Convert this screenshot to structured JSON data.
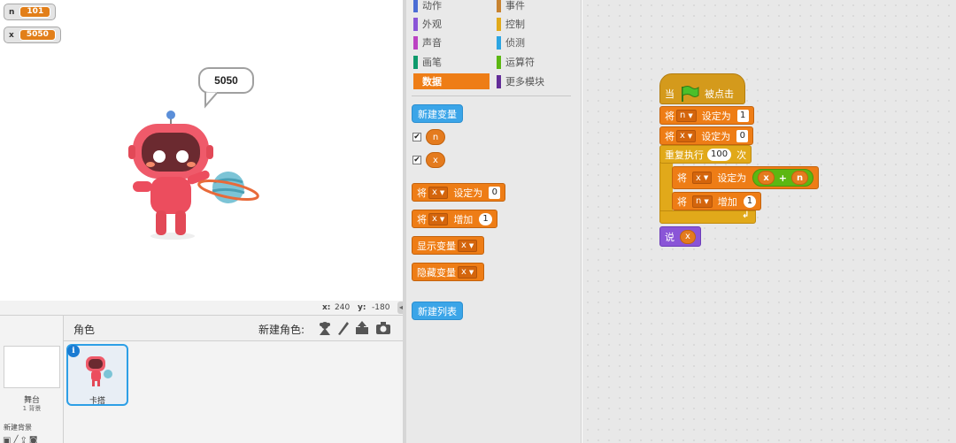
{
  "stage": {
    "monitors": [
      {
        "name": "n",
        "value": "101"
      },
      {
        "name": "x",
        "value": "5050"
      }
    ],
    "speech": "5050"
  },
  "coords": {
    "x_label": "x:",
    "x_value": "240",
    "y_label": "y:",
    "y_value": "-180"
  },
  "sprites": {
    "header_title": "角色",
    "new_sprite_label": "新建角色:",
    "stage_label": "舞台",
    "stage_backdrops": "1 背景",
    "new_backdrop_label": "新建背景",
    "sprite_name": "卡搭",
    "info_icon": "i"
  },
  "palette": {
    "categories": [
      {
        "label": "动作",
        "color": "#4a6cd4"
      },
      {
        "label": "事件",
        "color": "#c88330"
      },
      {
        "label": "外观",
        "color": "#8a55d7"
      },
      {
        "label": "控制",
        "color": "#e1a91a"
      },
      {
        "label": "声音",
        "color": "#bb42c3"
      },
      {
        "label": "侦测",
        "color": "#2ca5e2"
      },
      {
        "label": "画笔",
        "color": "#0e9a6c"
      },
      {
        "label": "运算符",
        "color": "#5cb712"
      },
      {
        "label": "数据",
        "color": "#ee7d16"
      },
      {
        "label": "更多模块",
        "color": "#632d99"
      }
    ],
    "new_variable": "新建变量",
    "variables": [
      "n",
      "x"
    ],
    "check": "✔",
    "blocks": {
      "set_prefix": "将",
      "set_var": "x",
      "set_mid": "设定为",
      "set_val": "0",
      "change_prefix": "将",
      "change_var": "x",
      "change_mid": "增加",
      "change_val": "1",
      "show_label": "显示变量",
      "show_var": "x",
      "hide_label": "隐藏变量",
      "hide_var": "x"
    },
    "new_list": "新建列表"
  },
  "script": {
    "when": "当",
    "clicked": "被点击",
    "set1": {
      "prefix": "将",
      "var": "n",
      "mid": "设定为",
      "val": "1"
    },
    "set2": {
      "prefix": "将",
      "var": "x",
      "mid": "设定为",
      "val": "0"
    },
    "repeat": {
      "label": "重复执行",
      "count": "100",
      "suffix": "次"
    },
    "set3": {
      "prefix": "将",
      "var": "x",
      "mid": "设定为",
      "a": "x",
      "op": "+",
      "b": "n"
    },
    "change": {
      "prefix": "将",
      "var": "n",
      "mid": "增加",
      "val": "1"
    },
    "say": {
      "label": "说",
      "var": "x"
    }
  }
}
